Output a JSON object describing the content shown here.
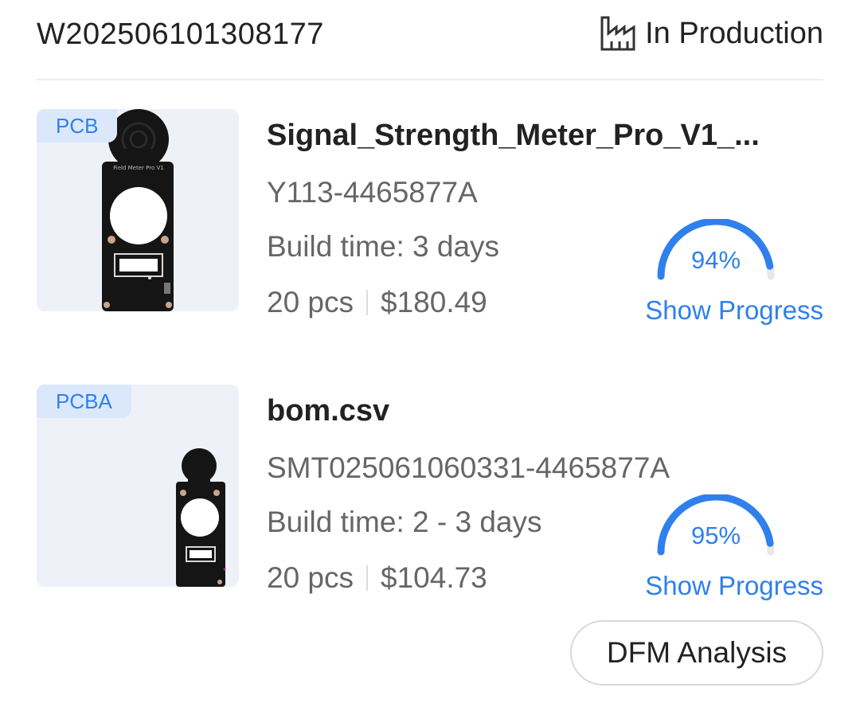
{
  "order": {
    "id": "W202506101308177",
    "status_label": "In Production",
    "status_icon": "factory-icon"
  },
  "items": [
    {
      "tag": "PCB",
      "name": "Signal_Strength_Meter_Pro_V1_...",
      "code": "Y113-4465877A",
      "build_time": "Build time: 3 days",
      "quantity": "20 pcs",
      "price": "$180.49",
      "progress": 0.94,
      "progress_label": "94%",
      "show_progress_label": "Show Progress",
      "board_silkscreen": "Field Meter Pro V1"
    },
    {
      "tag": "PCBA",
      "name": "bom.csv",
      "code": "SMT025061060331-4465877A",
      "build_time": "Build time: 2 - 3 days",
      "quantity": "20 pcs",
      "price": "$104.73",
      "progress": 0.95,
      "progress_label": "95%",
      "show_progress_label": "Show Progress"
    }
  ],
  "actions": {
    "dfm_label": "DFM Analysis"
  },
  "colors": {
    "accent": "#2f80ed",
    "tag_bg": "#dbe8fb",
    "thumb_bg": "#eef2f8",
    "gauge_track": "#e8e8e8"
  }
}
